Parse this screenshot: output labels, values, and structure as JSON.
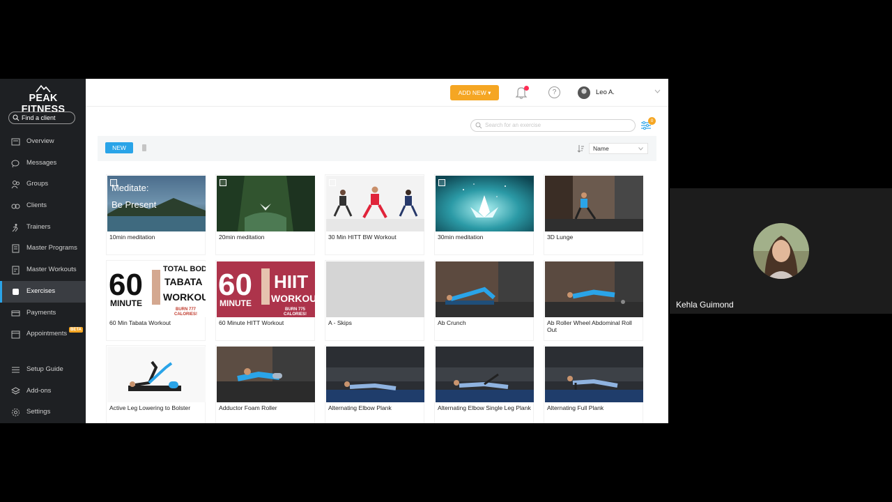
{
  "sidebar": {
    "logo_text": "PEAK FITNESS",
    "find_client_placeholder": "Find a client",
    "items": [
      {
        "label": "Overview",
        "icon": "overview-icon"
      },
      {
        "label": "Messages",
        "icon": "messages-icon"
      },
      {
        "label": "Groups",
        "icon": "groups-icon"
      },
      {
        "label": "Clients",
        "icon": "clients-icon"
      },
      {
        "label": "Trainers",
        "icon": "trainers-icon"
      },
      {
        "label": "Master Programs",
        "icon": "programs-icon"
      },
      {
        "label": "Master Workouts",
        "icon": "workouts-icon"
      },
      {
        "label": "Exercises",
        "icon": "exercises-icon",
        "active": true
      },
      {
        "label": "Payments",
        "icon": "payments-icon"
      },
      {
        "label": "Appointments",
        "icon": "calendar-icon",
        "badge": "BETA"
      }
    ],
    "bottom_items": [
      {
        "label": "Setup Guide",
        "icon": "setup-guide-icon"
      },
      {
        "label": "Add-ons",
        "icon": "addons-icon"
      },
      {
        "label": "Settings",
        "icon": "gear-icon"
      }
    ]
  },
  "header": {
    "add_new_label": "ADD NEW ▾",
    "help_label": "?",
    "user_name": "Leo A."
  },
  "search": {
    "placeholder": "Search for an exercise",
    "filter_count": "0"
  },
  "toolbar": {
    "tab_new": "NEW",
    "sort_value": "Name"
  },
  "exercises": [
    {
      "label": "10min meditation",
      "thumb_text": "Meditate:\nBe Present"
    },
    {
      "label": "20min meditation"
    },
    {
      "label": "30 Min HITT BW Workout"
    },
    {
      "label": "30min meditation"
    },
    {
      "label": "3D Lunge"
    },
    {
      "label": "60 Min Tabata Workout",
      "thumb_text": "60 MINUTE TOTAL BODY TABATA WORKOUT BURN 777 CALORIES!"
    },
    {
      "label": "60 Minute HITT Workout",
      "thumb_text": "60 MINUTE HIIT WORKOUT BURN 775 CALORIES!"
    },
    {
      "label": "A - Skips"
    },
    {
      "label": "Ab Crunch"
    },
    {
      "label": "Ab Roller Wheel Abdominal Roll Out"
    },
    {
      "label": "Active Leg Lowering to Bolster"
    },
    {
      "label": "Adductor Foam Roller"
    },
    {
      "label": "Alternating Elbow Plank"
    },
    {
      "label": "Alternating Elbow Single Leg Plank"
    },
    {
      "label": "Alternating Full Plank"
    }
  ],
  "video_tile": {
    "participant_name": "Kehla Guimond"
  },
  "colors": {
    "accent_blue": "#2aa4e8",
    "add_new_orange": "#f5a623",
    "sidebar_bg": "#1e2023",
    "notification_red": "#ff2d55"
  }
}
